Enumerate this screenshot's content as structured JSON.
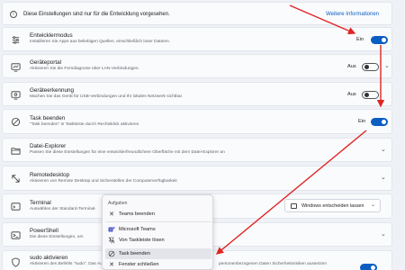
{
  "info": {
    "text": "Diese Einstellungen sind nur für die Entwicklung vorgesehen.",
    "link": "Weitere Informationen"
  },
  "rows": [
    {
      "title": "Entwicklermodus",
      "subtitle": "Installieren Sie Apps aus beliebigen Quellen, einschließlich loser Dateien.",
      "toggle_label": "Ein",
      "state": "on"
    },
    {
      "title": "Geräteportal",
      "subtitle": "Aktivieren Sie die Ferndiagnose über LAN-Verbindungen.",
      "toggle_label": "Aus",
      "state": "off"
    },
    {
      "title": "Geräteerkennung",
      "subtitle": "Machen Sie das Gerät für USB-Verbindungen und Ihr lokales Netzwerk sichtbar.",
      "toggle_label": "Aus",
      "state": "off"
    },
    {
      "title": "Task beenden",
      "subtitle": "\"Task beenden\" in Taskleiste durch Rechtsklick aktivieren",
      "toggle_label": "Ein",
      "state": "on"
    },
    {
      "title": "Datei-Explorer",
      "subtitle": "Passen Sie diese Einstellungen für eine entwicklerfreundlichere Oberfläche mit dem Datei-Explorer an"
    },
    {
      "title": "Remotedesktop",
      "subtitle": "Aktivieren von Remote Desktop und Sicherstellen der Computerverfügbarkeit"
    },
    {
      "title": "Terminal",
      "subtitle": "Auswählen der Standard-Terminal-"
    },
    {
      "title": "PowerShell",
      "subtitle": "Die diese Einstellungen, um"
    },
    {
      "title": "sudo aktivieren",
      "subtitle": "Aktivieren des Befehls \"sudo\". Das Ausführen von",
      "subtitle_right": "personenbezogenen Daten Sicherheitsrisiken aussetzen"
    }
  ],
  "terminal_select": {
    "value": "Windows entscheiden lassen"
  },
  "context_menu": {
    "header": "Aufgaben",
    "items": [
      {
        "label": "Teams beenden",
        "icon": "close-icon"
      },
      {
        "label": "Microsoft Teams",
        "icon": "teams-icon"
      },
      {
        "label": "Von Taskleiste lösen",
        "icon": "unpin-icon"
      },
      {
        "label": "Task beenden",
        "icon": "end-task-icon"
      },
      {
        "label": "Fenster schließen",
        "icon": "close-icon"
      }
    ]
  },
  "colors": {
    "accent": "#0a5ec2",
    "annotation_arrow": "#e02424"
  }
}
